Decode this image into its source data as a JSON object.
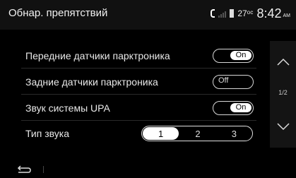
{
  "header": {
    "title": "Обнар. препятствий",
    "temperature": "27ᵒᶜ",
    "time": "8:42",
    "ampm": "AM",
    "icons": [
      "phone-icon",
      "signal-icon",
      "battery-icon"
    ]
  },
  "settings": {
    "front_sensors": {
      "label": "Передние датчики парктроника",
      "state": "On"
    },
    "rear_sensors": {
      "label": "Задние датчики парктроника",
      "state": "Off"
    },
    "upa_sound": {
      "label": "Звук системы UPA",
      "state": "On"
    },
    "sound_type": {
      "label": "Тип звука",
      "options": [
        "1",
        "2",
        "3"
      ],
      "selected": "1"
    }
  },
  "scroll": {
    "page": "1/2",
    "up_icon": "chevron-up-icon",
    "down_icon": "chevron-down-icon"
  },
  "footer": {
    "back_icon": "back-arrow-icon"
  },
  "colors": {
    "background": "#000000",
    "header": "#111111",
    "text": "#e8e8e8",
    "toggle_on": "#ffffff"
  }
}
